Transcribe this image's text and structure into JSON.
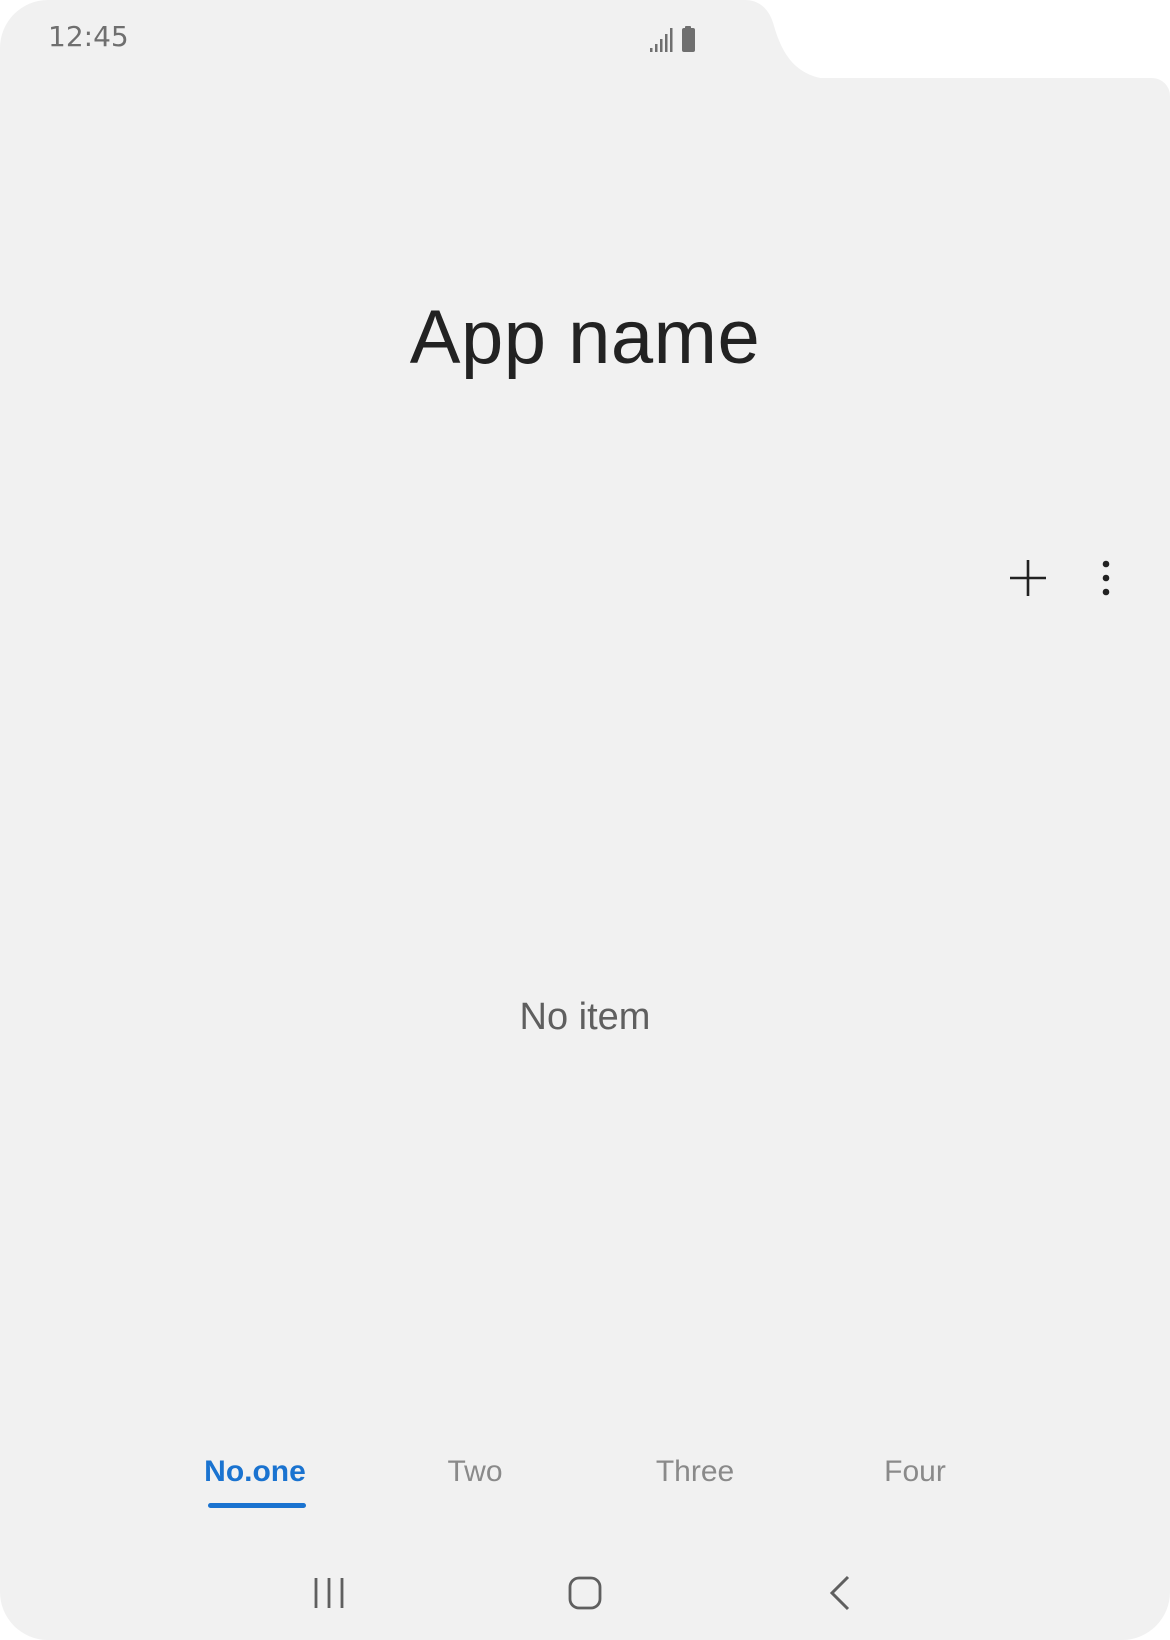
{
  "status_bar": {
    "time": "12:45",
    "signal_icon": "signal-icon",
    "battery_icon": "battery-icon"
  },
  "app": {
    "title": "App name"
  },
  "actions": {
    "add_icon": "plus-icon",
    "more_icon": "more-vertical-icon"
  },
  "content": {
    "empty_message": "No item"
  },
  "tabs": [
    {
      "label": "No.one",
      "selected": true
    },
    {
      "label": "Two",
      "selected": false
    },
    {
      "label": "Three",
      "selected": false
    },
    {
      "label": "Four",
      "selected": false
    }
  ],
  "navigation_bar": {
    "recent_icon": "recent-apps-icon",
    "home_icon": "home-icon",
    "back_icon": "back-icon"
  },
  "colors": {
    "accent": "#1a73d0",
    "background": "#f1f1f1",
    "outer_background": "#ffffff"
  }
}
